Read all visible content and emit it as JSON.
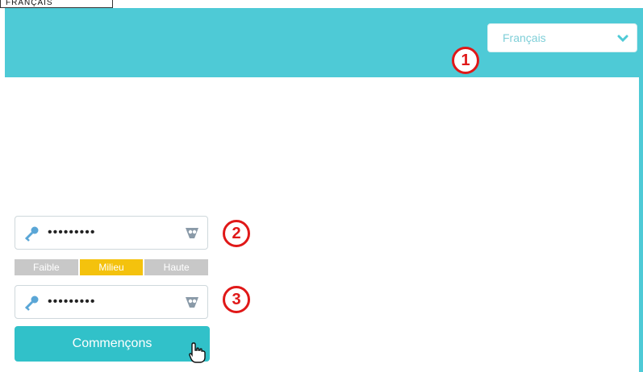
{
  "top_label": "FRANÇAIS",
  "language": {
    "selected": "Français"
  },
  "badges": [
    "1",
    "2",
    "3"
  ],
  "password": {
    "value": "•••••••••"
  },
  "confirm_password": {
    "value": "•••••••••"
  },
  "strength": {
    "weak": "Faible",
    "medium": "Milieu",
    "high": "Haute"
  },
  "start_button": "Commençons",
  "colors": {
    "accent": "#4ecad6",
    "button": "#31c1c9",
    "badge": "#e01818",
    "medium": "#f4c20d"
  }
}
